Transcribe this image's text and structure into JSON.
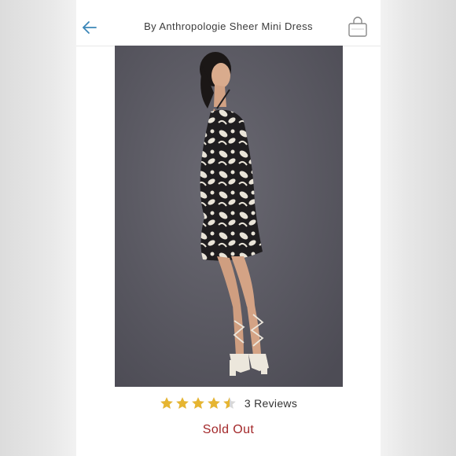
{
  "header": {
    "back_icon": "back-arrow-icon",
    "title": "By Anthropologie Sheer Mini Dress",
    "bag_icon": "shopping-bag-icon"
  },
  "product": {
    "image_alt": "Model wearing a black and white floral sheer mini dress with white lace-up heels"
  },
  "rating": {
    "value": 4.5,
    "max": 5,
    "reviews_label": "3 Reviews"
  },
  "status": {
    "label": "Sold Out"
  },
  "colors": {
    "accent": "#3b87b8",
    "star": "#e6b531",
    "status": "#a3282a",
    "photo_background": "#5b5a63"
  }
}
